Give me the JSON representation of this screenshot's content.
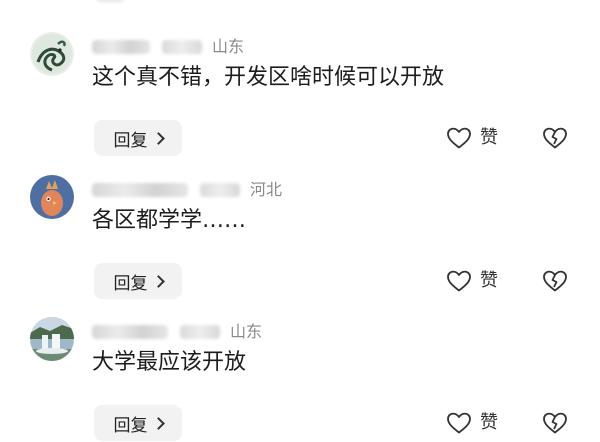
{
  "comments": [
    {
      "location": "山东",
      "text": "这个真不错，开发区啥时候可以开放",
      "reply_label": "回复",
      "like_label": "赞"
    },
    {
      "location": "河北",
      "text": "各区都学学……",
      "reply_label": "回复",
      "like_label": "赞"
    },
    {
      "location": "山东",
      "text": "大学最应该开放",
      "reply_label": "回复",
      "like_label": "赞"
    }
  ],
  "icons": {
    "like": "heart-outline-icon",
    "dislike": "broken-heart-icon",
    "reply_arrow": "chevron-right-icon"
  },
  "colors": {
    "location": "#8a8a8a",
    "reply_background": "#f2f2f2",
    "text": "#1c1c1c"
  }
}
